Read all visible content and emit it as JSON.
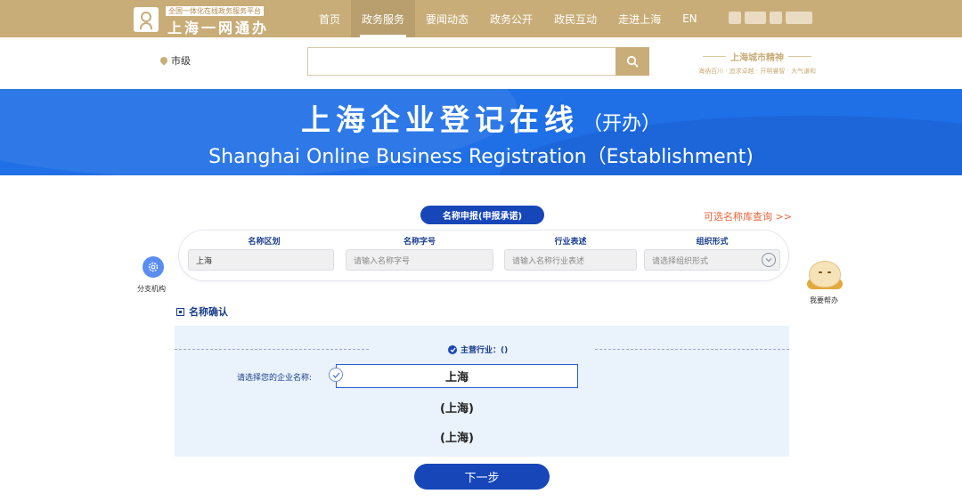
{
  "header": {
    "logo_tagline": "全国一体化在线政务服务平台",
    "logo_name": "上海一网通办",
    "nav": [
      {
        "label": "首页"
      },
      {
        "label": "政务服务"
      },
      {
        "label": "要闻动态"
      },
      {
        "label": "政务公开"
      },
      {
        "label": "政民互动"
      },
      {
        "label": "走进上海"
      },
      {
        "label": "EN"
      }
    ],
    "active_nav": "政务服务"
  },
  "location": {
    "label": "市级"
  },
  "search": {
    "placeholder": "",
    "value": ""
  },
  "slogan": {
    "title": "上海城市精神",
    "subtitle": "海纳百川 · 追求卓越 · 开明睿智 · 大气谦和"
  },
  "banner": {
    "title_cn": "上海企业登记在线",
    "title_cn_suffix": "（开办）",
    "title_en": "Shanghai Online Business Registration（Establishment)"
  },
  "name_form": {
    "tab_label": "名称申报(申报承诺)",
    "query_link": "可选名称库查询 >>",
    "fields": [
      {
        "label": "名称区划",
        "value": "上海",
        "placeholder": ""
      },
      {
        "label": "名称字号",
        "value": "",
        "placeholder": "请输入名称字号"
      },
      {
        "label": "行业表述",
        "value": "",
        "placeholder": "请输入名称行业表述"
      },
      {
        "label": "组织形式",
        "value": "",
        "placeholder": "请选择组织形式"
      }
    ]
  },
  "side": {
    "branch_label": "分支机构",
    "helper_label": "我要帮办"
  },
  "confirm": {
    "title": "名称确认",
    "industry_label": "主营行业：()",
    "choose_label": "请选择您的企业名称:",
    "options": [
      "上海",
      "(上海)",
      "(上海)"
    ],
    "selected_index": 0
  },
  "actions": {
    "next_label": "下一步"
  },
  "colors": {
    "nav_gold": "#c9ad78",
    "banner_blue": "#1f6fe6",
    "primary_navy": "#1746b8",
    "link_orange": "#e8663a",
    "panel_bg": "#eaf2fc"
  }
}
